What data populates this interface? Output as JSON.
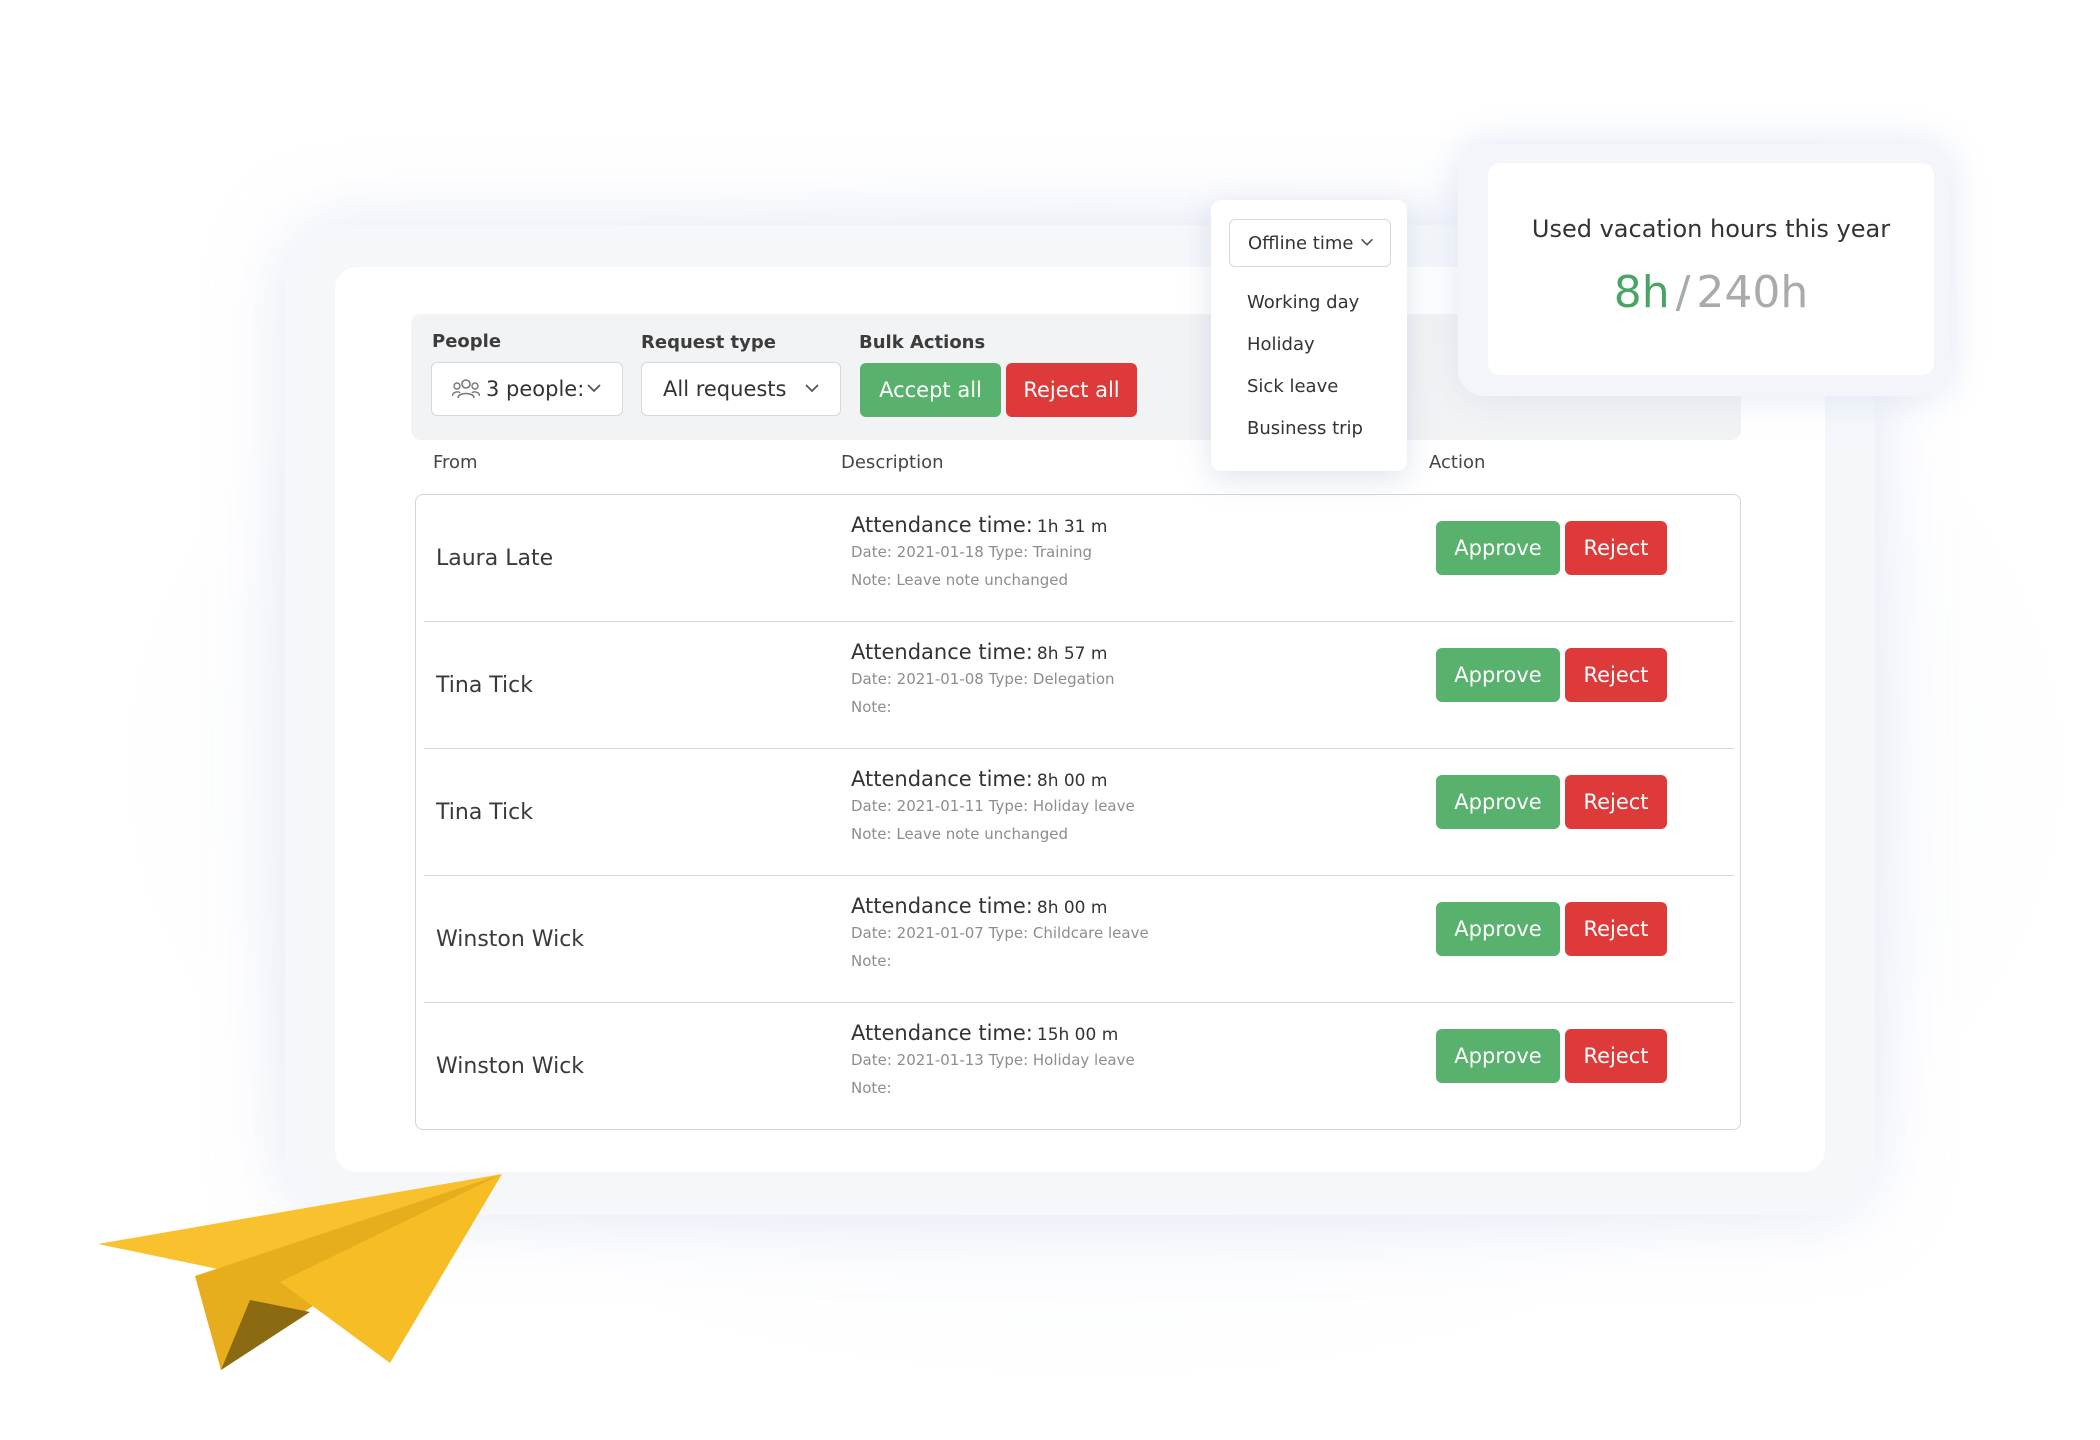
{
  "filters": {
    "people": {
      "label": "People",
      "value": "3 people:"
    },
    "request_type": {
      "label": "Request type",
      "value": "All requests"
    },
    "bulk_actions": {
      "label": "Bulk Actions",
      "accept_all": "Accept all",
      "reject_all": "Reject all"
    }
  },
  "table": {
    "columns": {
      "from": "From",
      "description": "Description",
      "action": "Action"
    },
    "rows": [
      {
        "from": "Laura Late",
        "attendance_label": "Attendance time:",
        "attendance_value": "1h 31 m",
        "date_type": "Date: 2021-01-18 Type: Training",
        "note": "Note: Leave note unchanged",
        "approve": "Approve",
        "reject": "Reject"
      },
      {
        "from": "Tina Tick",
        "attendance_label": "Attendance time:",
        "attendance_value": "8h 57 m",
        "date_type": "Date: 2021-01-08 Type: Delegation",
        "note": "Note:",
        "approve": "Approve",
        "reject": "Reject"
      },
      {
        "from": "Tina Tick",
        "attendance_label": "Attendance time:",
        "attendance_value": "8h 00 m",
        "date_type": "Date: 2021-01-11 Type: Holiday leave",
        "note": "Note: Leave note unchanged",
        "approve": "Approve",
        "reject": "Reject"
      },
      {
        "from": "Winston Wick",
        "attendance_label": "Attendance time:",
        "attendance_value": "8h 00 m",
        "date_type": "Date: 2021-01-07 Type: Childcare leave",
        "note": "Note:",
        "approve": "Approve",
        "reject": "Reject"
      },
      {
        "from": "Winston Wick",
        "attendance_label": "Attendance time:",
        "attendance_value": "15h 00 m",
        "date_type": "Date: 2021-01-13 Type: Holiday leave",
        "note": "Note:",
        "approve": "Approve",
        "reject": "Reject"
      }
    ]
  },
  "dropdown": {
    "selected": "Offline time",
    "options": [
      "Working day",
      "Holiday",
      "Sick leave",
      "Business trip"
    ]
  },
  "vacation": {
    "title": "Used vacation hours this year",
    "used": "8h",
    "separator": "/",
    "total": "240h"
  },
  "colors": {
    "approve": "#58b26d",
    "reject": "#df3a3a",
    "used_hours": "#4aa565",
    "total_hours": "#aaaaaa",
    "paper_plane": "#f9c12e"
  },
  "icons": {
    "people": "people-group-icon",
    "dropdown": "chevron-down-icon",
    "decoration": "paper-plane-icon"
  }
}
